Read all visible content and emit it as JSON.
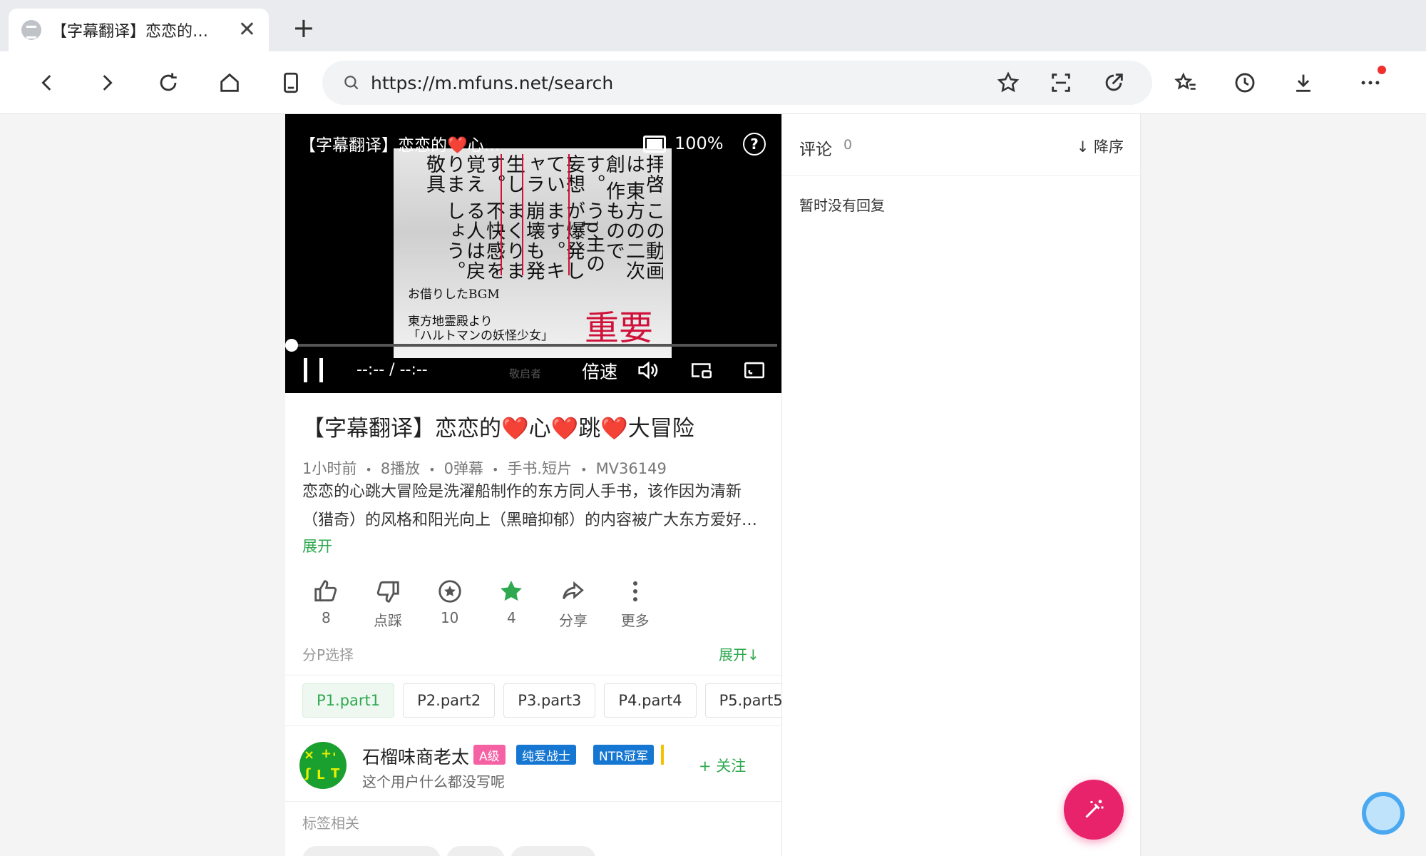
{
  "browser": {
    "tab_title": "【字幕翻译】恋恋的…",
    "url": "https://m.mfuns.net/search"
  },
  "player": {
    "title": "【字幕翻译】恋恋的❤️心…",
    "battery_pct": "100%",
    "help": "?",
    "time": "--:-- / --:--",
    "watermark": "敬启者",
    "speed_label": "倍速",
    "frame": {
      "vertical_text": "拝啓 この動画は 東方の二次創 作ものです。 うp主の妄想 が爆発してい ます。キャラ 崩壊も発生し まくります。 不快感を覚え る人は戻りま しょう。敬具",
      "bgm": "お借りしたBGM",
      "source1": "東方地霊殿より",
      "source2": "「ハルトマンの妖怪少女」",
      "note": "重要"
    }
  },
  "video": {
    "title": "【字幕翻译】恋恋的❤️心❤️跳❤️大冒险",
    "meta": {
      "time": "1小时前",
      "plays": "8播放",
      "danmaku": "0弹幕",
      "category": "手书.短片",
      "id": "MV36149"
    },
    "description": "恋恋的心跳大冒险是洗濯船制作的东方同人手书，该作因为清新（猎奇）的风格和阳光向上（黑暗抑郁）的内容被广大东方爱好者所喜爱。",
    "expand": "展开",
    "actions": {
      "like": "8",
      "dislike": "点踩",
      "coin": "10",
      "favorite": "4",
      "share": "分享",
      "more": "更多"
    },
    "parts_header": "分P选择",
    "parts_expand": "展开↓",
    "parts": [
      "P1.part1",
      "P2.part2",
      "P3.part3",
      "P4.part4",
      "P5.part5"
    ]
  },
  "uploader": {
    "name": "石榴味商老太",
    "badges": [
      "A级",
      "纯爱战士",
      "NTR冠军"
    ],
    "bio": "这个用户什么都没写呢",
    "follow": "+ 关注"
  },
  "tags_header": "标签相关",
  "comments": {
    "title": "评论",
    "count": "0",
    "sort": "↓ 降序",
    "empty": "暂时没有回复"
  },
  "colors": {
    "accent": "#2ea94f",
    "fab": "#e8236b",
    "badge_a": "#f562a4",
    "badge_blue": "#1677d2",
    "badge_yellow": "#f2c200"
  }
}
